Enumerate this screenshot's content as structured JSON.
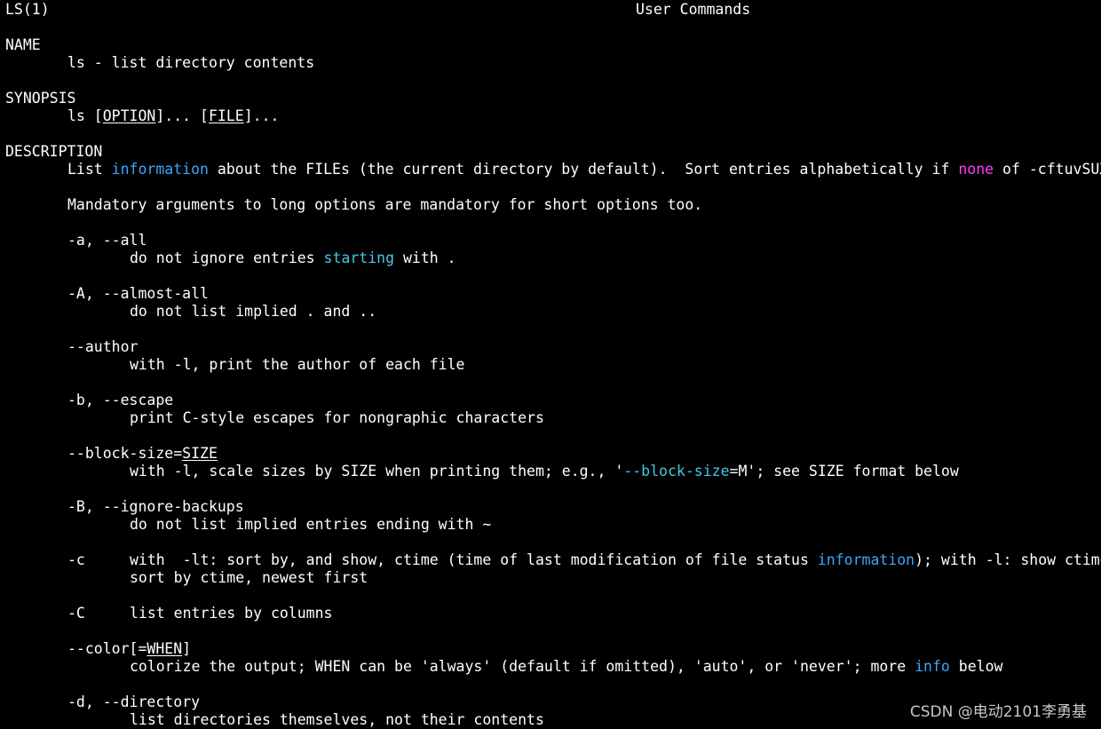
{
  "header": {
    "left": "LS(1)",
    "center": "User Commands"
  },
  "sections": {
    "name": {
      "title": "NAME",
      "text": "ls - list directory contents"
    },
    "synopsis": {
      "title": "SYNOPSIS",
      "prefix": "ls [",
      "option": "OPTION",
      "mid": "]... [",
      "file": "FILE",
      "suffix": "]..."
    },
    "description": {
      "title": "DESCRIPTION",
      "line1_a": "List ",
      "line1_hl1": "information",
      "line1_b": " about the FILEs (the current directory by default).  Sort entries alphabetically if ",
      "line1_hl2": "none",
      "line1_c": " of -cftuvSUX",
      "mandatory": "Mandatory arguments to long options are mandatory for short options too."
    }
  },
  "options": {
    "all": {
      "flag": "-a, --all",
      "desc_a": "do not ignore entries ",
      "desc_hl": "starting",
      "desc_b": " with ."
    },
    "almost_all": {
      "flag": "-A, --almost-all",
      "desc": "do not list implied . and .."
    },
    "author": {
      "flag": "--author",
      "desc": "with -l, print the author of each file"
    },
    "escape": {
      "flag": "-b, --escape",
      "desc": "print C-style escapes for nongraphic characters"
    },
    "block_size": {
      "flag_a": "--block-size=",
      "flag_arg": "SIZE",
      "desc_a": "with -l, scale sizes by SIZE when printing them; e.g., '",
      "desc_hl": "--block-size",
      "desc_b": "=M'; see SIZE format below"
    },
    "ignore_backups": {
      "flag": "-B, --ignore-backups",
      "desc": "do not list implied entries ending with ~"
    },
    "ctime": {
      "flag": "-c",
      "desc1_a": "with  -lt: sort by, and show, ctime (time of last modification of file status ",
      "desc1_hl": "information",
      "desc1_b": "); with -l: show ctime",
      "desc2": "sort by ctime, newest first"
    },
    "columns": {
      "flag": "-C",
      "desc": "list entries by columns"
    },
    "color": {
      "flag_a": "--color[=",
      "flag_arg": "WHEN",
      "flag_b": "]",
      "desc_a": "colorize the output; WHEN can be 'always' (default if omitted), 'auto', or 'never'; more ",
      "desc_hl": "info",
      "desc_b": " below"
    },
    "directory": {
      "flag": "-d, --directory",
      "desc": "list directories themselves, not their contents"
    }
  },
  "watermark": "CSDN @电动2101李勇基",
  "colors": {
    "background": "#000000",
    "text": "#ffffff",
    "highlight_blue": "#3aa6ff",
    "highlight_cyan": "#47c6e6",
    "highlight_magenta": "#ff3cff"
  }
}
